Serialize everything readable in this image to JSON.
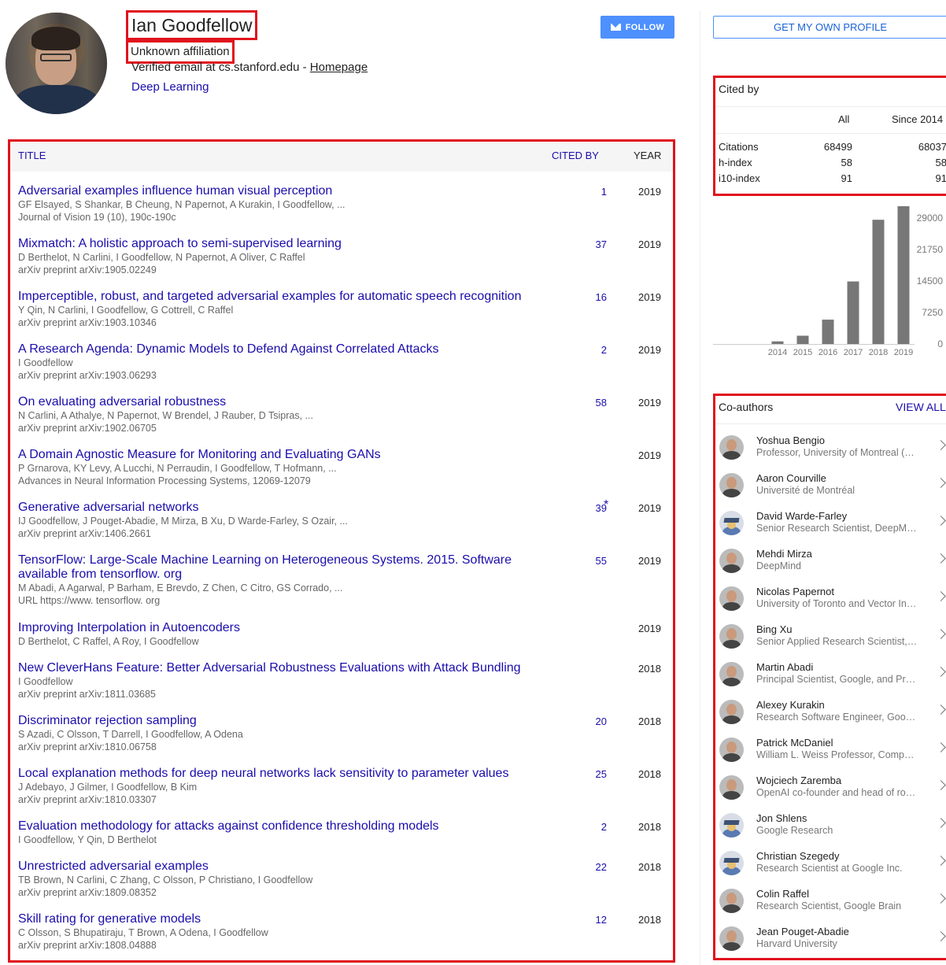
{
  "profile": {
    "name": "Ian Goodfellow",
    "affiliation": "Unknown affiliation",
    "email_text": "Verified email at cs.stanford.edu - ",
    "homepage_label": "Homepage",
    "interest": "Deep Learning",
    "follow_label": "FOLLOW",
    "get_profile_label": "GET MY OWN PROFILE"
  },
  "table": {
    "col_title": "TITLE",
    "col_cited": "CITED BY",
    "col_year": "YEAR",
    "star": "*"
  },
  "publications": [
    {
      "title": "Adversarial examples influence human visual perception",
      "authors": "GF Elsayed, S Shankar, B Cheung, N Papernot, A Kurakin, I Goodfellow, ...",
      "venue": "Journal of Vision 19 (10), 190c-190c",
      "cited": "1",
      "year": "2019"
    },
    {
      "title": "Mixmatch: A holistic approach to semi-supervised learning",
      "authors": "D Berthelot, N Carlini, I Goodfellow, N Papernot, A Oliver, C Raffel",
      "venue": "arXiv preprint arXiv:1905.02249",
      "cited": "37",
      "year": "2019"
    },
    {
      "title": "Imperceptible, robust, and targeted adversarial examples for automatic speech recognition",
      "authors": "Y Qin, N Carlini, I Goodfellow, G Cottrell, C Raffel",
      "venue": "arXiv preprint arXiv:1903.10346",
      "cited": "16",
      "year": "2019"
    },
    {
      "title": "A Research Agenda: Dynamic Models to Defend Against Correlated Attacks",
      "authors": "I Goodfellow",
      "venue": "arXiv preprint arXiv:1903.06293",
      "cited": "2",
      "year": "2019"
    },
    {
      "title": "On evaluating adversarial robustness",
      "authors": "N Carlini, A Athalye, N Papernot, W Brendel, J Rauber, D Tsipras, ...",
      "venue": "arXiv preprint arXiv:1902.06705",
      "cited": "58",
      "year": "2019"
    },
    {
      "title": "A Domain Agnostic Measure for Monitoring and Evaluating GANs",
      "authors": "P Grnarova, KY Levy, A Lucchi, N Perraudin, I Goodfellow, T Hofmann, ...",
      "venue": "Advances in Neural Information Processing Systems, 12069-12079",
      "cited": "",
      "year": "2019"
    },
    {
      "title": "Generative adversarial networks",
      "authors": "IJ Goodfellow, J Pouget-Abadie, M Mirza, B Xu, D Warde-Farley, S Ozair, ...",
      "venue": "arXiv preprint arXiv:1406.2661",
      "cited": "39",
      "year": "2019"
    },
    {
      "title": "TensorFlow: Large-Scale Machine Learning on Heterogeneous Systems. 2015. Software available from tensorflow. org",
      "authors": "M Abadi, A Agarwal, P Barham, E Brevdo, Z Chen, C Citro, GS Corrado, ...",
      "venue": "URL https://www. tensorflow. org",
      "cited": "55",
      "year": "2019"
    },
    {
      "title": "Improving Interpolation in Autoencoders",
      "authors": "D Berthelot, C Raffel, A Roy, I Goodfellow",
      "venue": "",
      "cited": "",
      "year": "2019"
    },
    {
      "title": "New CleverHans Feature: Better Adversarial Robustness Evaluations with Attack Bundling",
      "authors": "I Goodfellow",
      "venue": "arXiv preprint arXiv:1811.03685",
      "cited": "",
      "year": "2018"
    },
    {
      "title": "Discriminator rejection sampling",
      "authors": "S Azadi, C Olsson, T Darrell, I Goodfellow, A Odena",
      "venue": "arXiv preprint arXiv:1810.06758",
      "cited": "20",
      "year": "2018"
    },
    {
      "title": "Local explanation methods for deep neural networks lack sensitivity to parameter values",
      "authors": "J Adebayo, J Gilmer, I Goodfellow, B Kim",
      "venue": "arXiv preprint arXiv:1810.03307",
      "cited": "25",
      "year": "2018"
    },
    {
      "title": "Evaluation methodology for attacks against confidence thresholding models",
      "authors": "I Goodfellow, Y Qin, D Berthelot",
      "venue": "",
      "cited": "2",
      "year": "2018"
    },
    {
      "title": "Unrestricted adversarial examples",
      "authors": "TB Brown, N Carlini, C Zhang, C Olsson, P Christiano, I Goodfellow",
      "venue": "arXiv preprint arXiv:1809.08352",
      "cited": "22",
      "year": "2018"
    },
    {
      "title": "Skill rating for generative models",
      "authors": "C Olsson, S Bhupatiraju, T Brown, A Odena, I Goodfellow",
      "venue": "arXiv preprint arXiv:1808.04888",
      "cited": "12",
      "year": "2018"
    }
  ],
  "cited_by": {
    "title": "Cited by",
    "col_all": "All",
    "col_since": "Since 2014",
    "rows": [
      {
        "label": "Citations",
        "all": "68499",
        "since": "68037"
      },
      {
        "label": "h-index",
        "all": "58",
        "since": "58"
      },
      {
        "label": "i10-index",
        "all": "91",
        "since": "91"
      }
    ]
  },
  "chart_data": {
    "type": "bar",
    "categories": [
      "2014",
      "2015",
      "2016",
      "2017",
      "2018",
      "2019"
    ],
    "values": [
      600,
      1900,
      5600,
      14400,
      28600,
      33300
    ],
    "ytick_labels": [
      "29000",
      "21750",
      "14500",
      "7250",
      "0"
    ],
    "ylim": [
      0,
      29000
    ],
    "colors": {
      "bar": "#777777"
    }
  },
  "coauthors": {
    "title": "Co-authors",
    "view_all": "VIEW ALL",
    "items": [
      {
        "name": "Yoshua Bengio",
        "affiliation": "Professor, University of Montreal (Mila, IVADO, CIFAR)",
        "avatar": "photo"
      },
      {
        "name": "Aaron Courville",
        "affiliation": "Université de Montréal",
        "avatar": "photo"
      },
      {
        "name": "David Warde-Farley",
        "affiliation": "Senior Research Scientist, DeepMind",
        "avatar": "placeholder"
      },
      {
        "name": "Mehdi Mirza",
        "affiliation": "DeepMind",
        "avatar": "photo"
      },
      {
        "name": "Nicolas Papernot",
        "affiliation": "University of Toronto and Vector Institute",
        "avatar": "photo"
      },
      {
        "name": "Bing Xu",
        "affiliation": "Senior Applied Research Scientist, Facebook",
        "avatar": "photo"
      },
      {
        "name": "Martin Abadi",
        "affiliation": "Principal Scientist, Google, and Professor Emeritus",
        "avatar": "photo"
      },
      {
        "name": "Alexey Kurakin",
        "affiliation": "Research Software Engineer, Google Brain",
        "avatar": "photo"
      },
      {
        "name": "Patrick McDaniel",
        "affiliation": "William L. Weiss Professor, Computer Science",
        "avatar": "photo"
      },
      {
        "name": "Wojciech Zaremba",
        "affiliation": "OpenAI co-founder and head of robotics",
        "avatar": "photo"
      },
      {
        "name": "Jon Shlens",
        "affiliation": "Google Research",
        "avatar": "placeholder"
      },
      {
        "name": "Christian Szegedy",
        "affiliation": "Research Scientist at Google Inc.",
        "avatar": "placeholder"
      },
      {
        "name": "Colin Raffel",
        "affiliation": "Research Scientist, Google Brain",
        "avatar": "photo"
      },
      {
        "name": "Jean Pouget-Abadie",
        "affiliation": "Harvard University",
        "avatar": "photo"
      }
    ]
  }
}
